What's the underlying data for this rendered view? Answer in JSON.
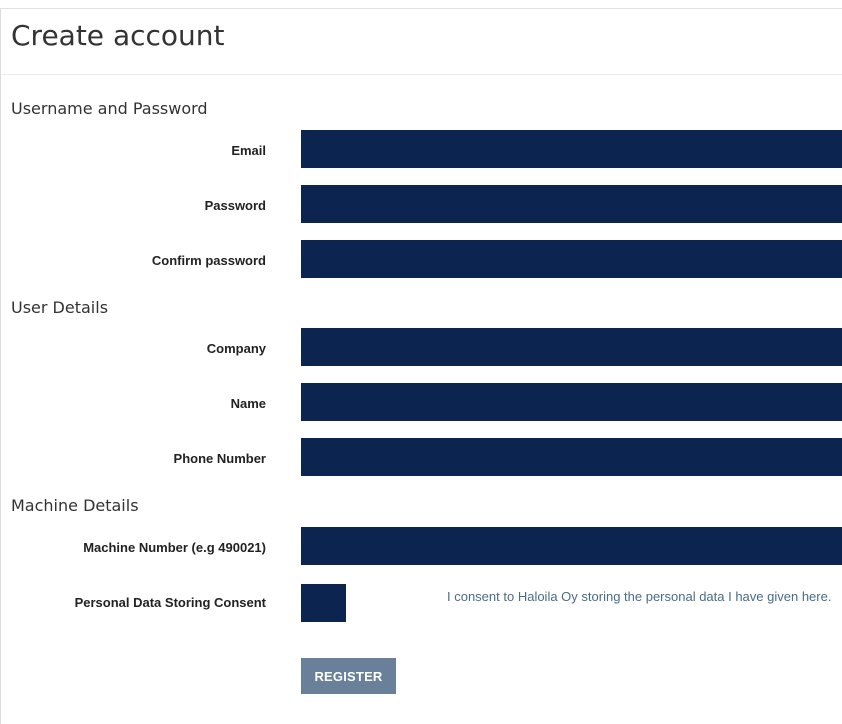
{
  "page": {
    "title": "Create account"
  },
  "sections": {
    "credentials": "Username and Password",
    "user_details": "User Details",
    "machine_details": "Machine Details"
  },
  "fields": {
    "email": {
      "label": "Email",
      "value": ""
    },
    "password": {
      "label": "Password",
      "value": ""
    },
    "confirm_password": {
      "label": "Confirm password",
      "value": ""
    },
    "company": {
      "label": "Company",
      "value": ""
    },
    "name": {
      "label": "Name",
      "value": ""
    },
    "phone": {
      "label": "Phone Number",
      "value": ""
    },
    "machine_number": {
      "label": "Machine Number (e.g 490021)",
      "value": ""
    }
  },
  "consent": {
    "label": "Personal Data Storing Consent",
    "text": "I consent to Haloila Oy storing the personal data I have given here.",
    "checked": false
  },
  "actions": {
    "register_label": "REGISTER"
  },
  "colors": {
    "field_background": "#0c2450",
    "button_background": "#6a7f99",
    "consent_text": "#4a6b8a"
  }
}
